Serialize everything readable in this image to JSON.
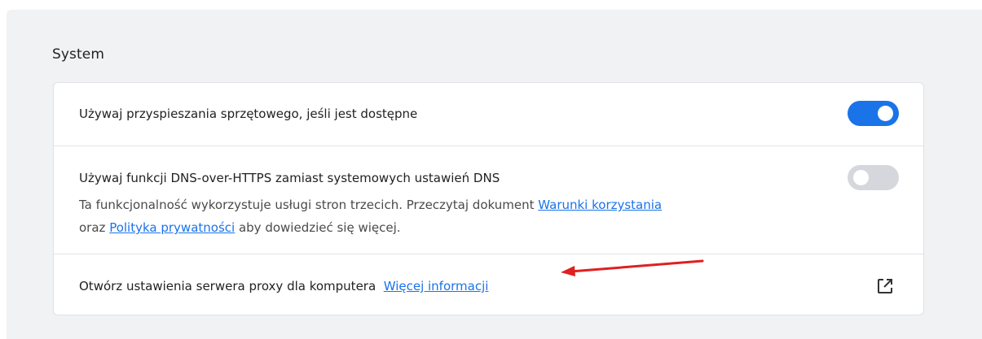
{
  "section": {
    "title": "System"
  },
  "settings": [
    {
      "label": "Używaj przyspieszania sprzętowego, jeśli jest dostępne",
      "toggle": "on"
    },
    {
      "label": "Używaj funkcji DNS-over-HTTPS zamiast systemowych ustawień DNS",
      "toggle": "off",
      "desc_line1_prefix": "Ta funkcjonalność wykorzystuje usługi stron trzecich. Przeczytaj dokument",
      "terms_link": "Warunki korzystania",
      "desc_line2_prefix": "oraz",
      "privacy_link": "Polityka prywatności",
      "desc_line2_suffix": "aby dowiedzieć się więcej."
    },
    {
      "label": "Otwórz ustawienia serwera proxy dla komputera",
      "more_link": "Więcej informacji",
      "icon": "external-link-icon"
    }
  ],
  "colors": {
    "accent": "#1a73e8",
    "toggle_off": "#d6d7dc",
    "annotation_arrow": "#e02020"
  }
}
